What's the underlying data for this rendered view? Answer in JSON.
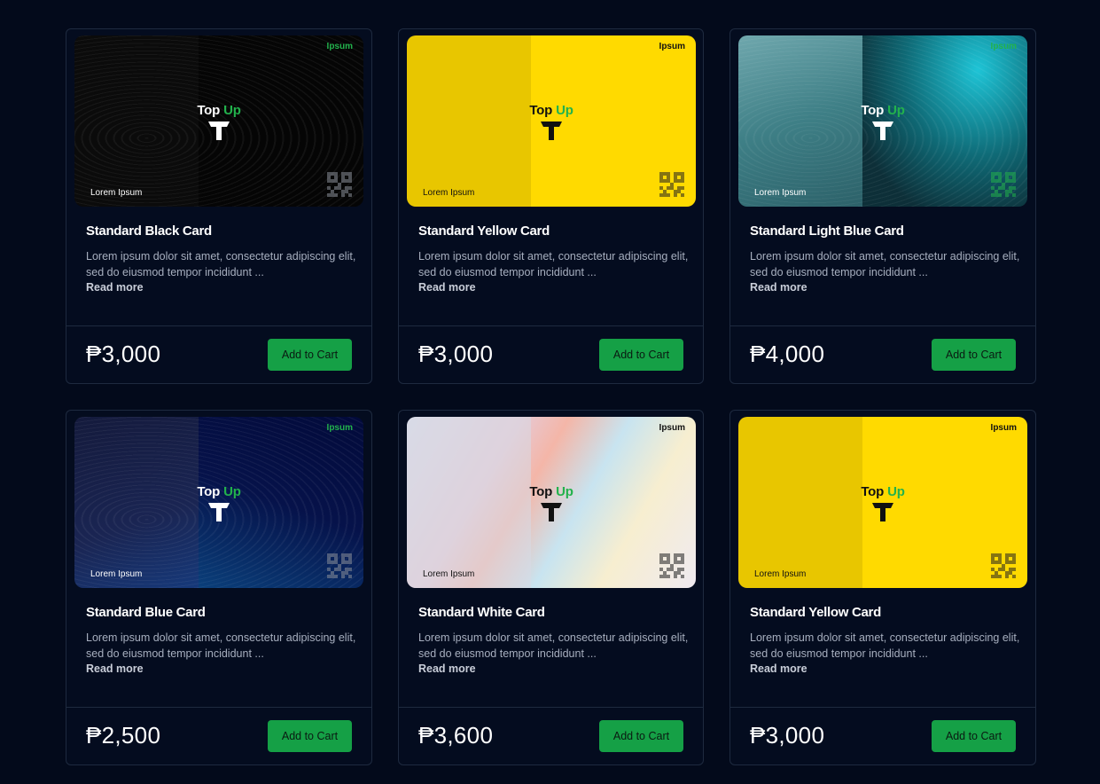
{
  "products": [
    {
      "title": "Standard Black Card",
      "description": "Lorem ipsum dolor sit amet, consectetur adipiscing elit, sed do eiusmod tempor incididunt ...",
      "read_more": "Read more",
      "price": "₱3,000",
      "cart_label": "Add to Cart",
      "card": {
        "brand": "Ipsum",
        "logo_top": "Top",
        "logo_up": "Up",
        "label": "Lorem Ipsum",
        "theme": "black",
        "left_color": "#0b0b0b",
        "right_color": "#050505",
        "text_color": "#ffffff",
        "brand_color": "#22b24c"
      }
    },
    {
      "title": "Standard Yellow Card",
      "description": "Lorem ipsum dolor sit amet, consectetur adipiscing elit, sed do eiusmod tempor incididunt ...",
      "read_more": "Read more",
      "price": "₱3,000",
      "cart_label": "Add to Cart",
      "card": {
        "brand": "Ipsum",
        "logo_top": "Top",
        "logo_up": "Up",
        "label": "Lorem Ipsum",
        "theme": "yellow",
        "left_color": "#e8c600",
        "right_color": "#ffda00",
        "text_color": "#111111",
        "brand_color": "#111111"
      }
    },
    {
      "title": "Standard Light Blue Card",
      "description": "Lorem ipsum dolor sit amet, consectetur adipiscing elit, sed do eiusmod tempor incididunt ...",
      "read_more": "Read more",
      "price": "₱4,000",
      "cart_label": "Add to Cart",
      "card": {
        "brand": "Ipsum",
        "logo_top": "Top",
        "logo_up": "Up",
        "label": "Lorem Ipsum",
        "theme": "lightblue",
        "left_color": "#3e7f86",
        "right_color": "#0f3d45",
        "text_color": "#ffffff",
        "brand_color": "#22b24c"
      }
    },
    {
      "title": "Standard Blue Card",
      "description": "Lorem ipsum dolor sit amet, consectetur adipiscing elit, sed do eiusmod tempor incididunt ...",
      "read_more": "Read more",
      "price": "₱2,500",
      "cart_label": "Add to Cart",
      "card": {
        "brand": "Ipsum",
        "logo_top": "Top",
        "logo_up": "Up",
        "label": "Lorem Ipsum",
        "theme": "blue",
        "left_color": "#1a2553",
        "right_color": "#06124a",
        "text_color": "#ffffff",
        "brand_color": "#22b24c"
      }
    },
    {
      "title": "Standard White Card",
      "description": "Lorem ipsum dolor sit amet, consectetur adipiscing elit, sed do eiusmod tempor incididunt ...",
      "read_more": "Read more",
      "price": "₱3,600",
      "cart_label": "Add to Cart",
      "card": {
        "brand": "Ipsum",
        "logo_top": "Top",
        "logo_up": "Up",
        "label": "Lorem Ipsum",
        "theme": "white",
        "left_color": "#dcdde8",
        "right_color": "#f3f0ea",
        "text_color": "#111111",
        "brand_color": "#111111"
      }
    },
    {
      "title": "Standard Yellow Card",
      "description": "Lorem ipsum dolor sit amet, consectetur adipiscing elit, sed do eiusmod tempor incididunt ...",
      "read_more": "Read more",
      "price": "₱3,000",
      "cart_label": "Add to Cart",
      "card": {
        "brand": "Ipsum",
        "logo_top": "Top",
        "logo_up": "Up",
        "label": "Lorem Ipsum",
        "theme": "yellow",
        "left_color": "#e8c600",
        "right_color": "#ffda00",
        "text_color": "#111111",
        "brand_color": "#111111"
      }
    }
  ],
  "colors": {
    "page_bg": "#030a1b",
    "accent": "#15a046",
    "border": "#1e2a3f"
  }
}
